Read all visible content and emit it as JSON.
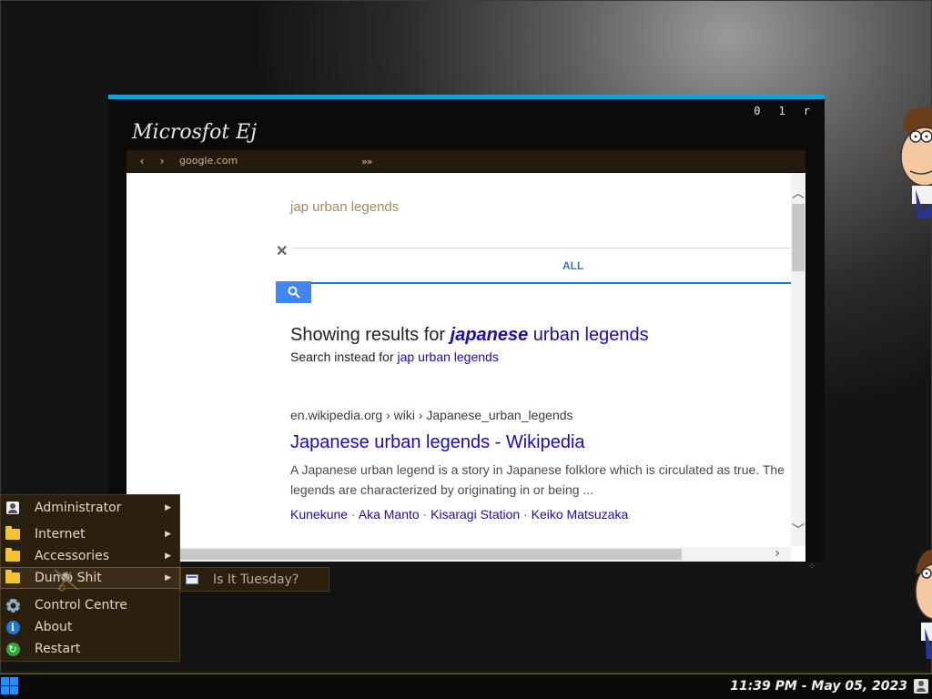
{
  "window": {
    "title": "Microsfot Ej",
    "controls": [
      "0",
      "1",
      "r"
    ]
  },
  "browser": {
    "back": "‹",
    "forward": "›",
    "url": "google.com",
    "go": "»»"
  },
  "search": {
    "query": "jap urban legends",
    "clear": "✕",
    "tab_all": "ALL",
    "showing_prefix": "Showing results for ",
    "showing_corrected": "japanese",
    "showing_rest": " urban legends",
    "instead_prefix": "Search instead for ",
    "instead_link": "jap urban legends"
  },
  "result": {
    "cite": "en.wikipedia.org › wiki › Japanese_urban_legends",
    "title": "Japanese urban legends - Wikipedia",
    "snippet_line1": "A Japanese urban legend is a story in Japanese folklore which is circulated as true. The",
    "snippet_line2": "legends are characterized by originating in or being ...",
    "sitelinks": [
      "Kunekune",
      "Aka Manto",
      "Kisaragi Station",
      "Keiko Matsuzaka"
    ],
    "sitelink_sep": " · "
  },
  "startmenu": {
    "items": [
      {
        "label": "Administrator",
        "icon": "user-icon",
        "arrow": "▶"
      },
      {
        "label": "Internet",
        "icon": "folder-icon",
        "arrow": "▶"
      },
      {
        "label": "Accessories",
        "icon": "folder-icon",
        "arrow": "▶"
      },
      {
        "label": "Dumb Shit",
        "icon": "folder-icon",
        "arrow": "▶"
      },
      {
        "label": "Control Centre",
        "icon": "gear-icon"
      },
      {
        "label": "About",
        "icon": "info-icon",
        "glyph": "i"
      },
      {
        "label": "Restart",
        "icon": "restart-icon",
        "glyph": "↻"
      }
    ],
    "submenu": {
      "label": "Is It Tuesday?",
      "icon": "app-window-icon"
    }
  },
  "taskbar": {
    "clock": "11:39 PM - May 05, 2023"
  },
  "colors": {
    "accent": "#1a9ed8",
    "menu_bg": "#2b1f10",
    "link": "#1a0dab",
    "google_blue": "#4285f4"
  }
}
